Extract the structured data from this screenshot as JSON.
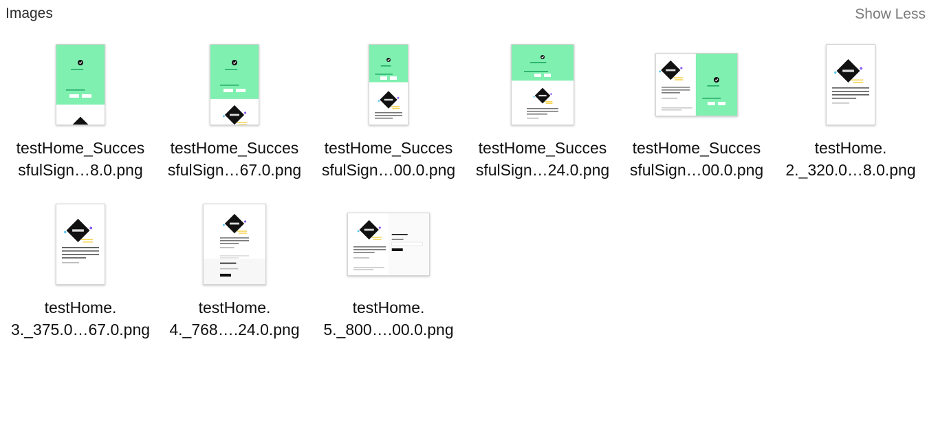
{
  "section": {
    "title": "Images",
    "toggle_label": "Show Less"
  },
  "files": [
    {
      "line1": "testHome_Succes",
      "line2": "sfulSign…8.0.png",
      "preview": "success-portrait-small"
    },
    {
      "line1": "testHome_Succes",
      "line2": "sfulSign…67.0.png",
      "preview": "success-portrait-logo"
    },
    {
      "line1": "testHome_Succes",
      "line2": "sfulSign…00.0.png",
      "preview": "success-portrait-tall"
    },
    {
      "line1": "testHome_Succes",
      "line2": "sfulSign…24.0.png",
      "preview": "success-tablet"
    },
    {
      "line1": "testHome_Succes",
      "line2": "sfulSign…00.0.png",
      "preview": "success-landscape"
    },
    {
      "line1": "testHome.",
      "line2": "2._320.0…8.0.png",
      "preview": "home-portrait"
    },
    {
      "line1": "testHome.",
      "line2": "3._375.0…67.0.png",
      "preview": "home-portrait"
    },
    {
      "line1": "testHome.",
      "line2": "4._768….24.0.png",
      "preview": "home-tablet"
    },
    {
      "line1": "testHome.",
      "line2": "5._800….00.0.png",
      "preview": "home-landscape"
    }
  ],
  "colors": {
    "mint": "#7ff0b0",
    "diamond": "#111111",
    "accent_purple": "#8b5cf6",
    "accent_yellow": "#f6d34a",
    "accent_blue": "#4fc3f7"
  }
}
